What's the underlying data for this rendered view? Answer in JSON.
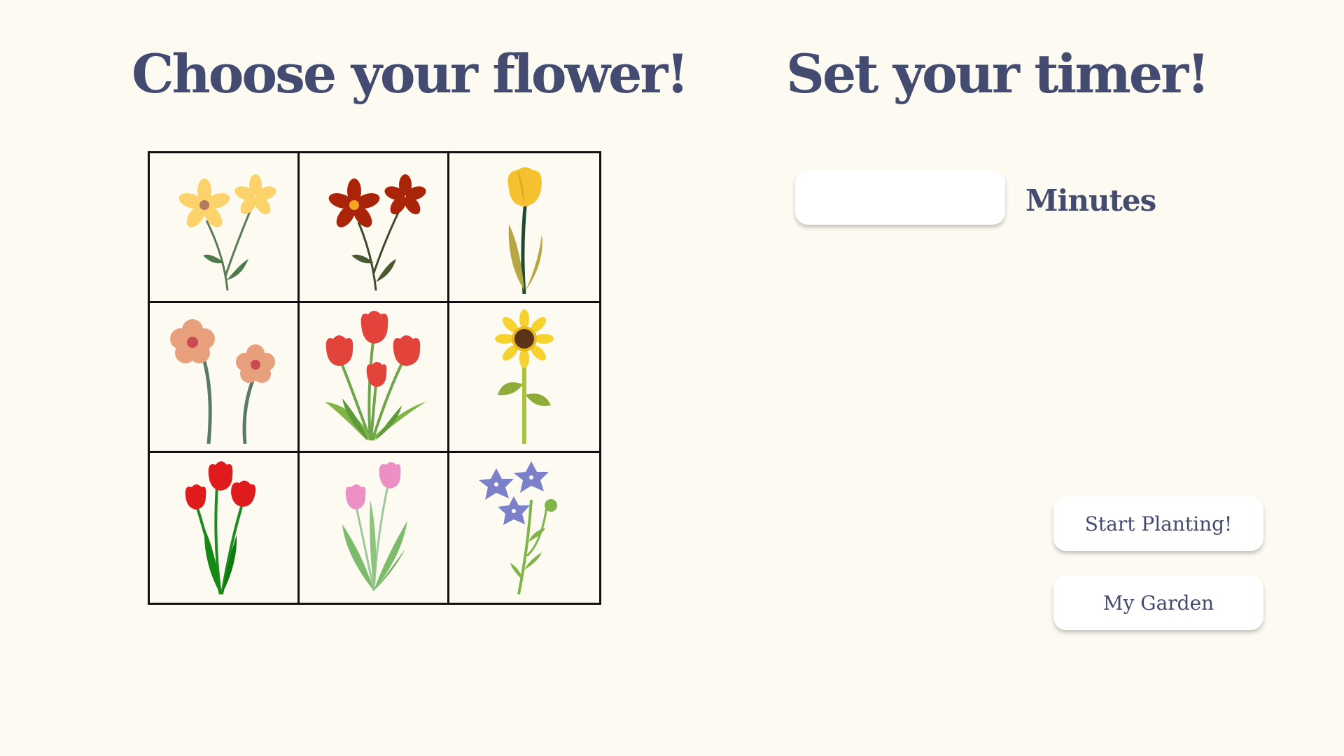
{
  "left_panel": {
    "title": "Choose your flower!",
    "flowers": [
      {
        "icon": "yellow-daisies-icon"
      },
      {
        "icon": "red-daisies-icon"
      },
      {
        "icon": "yellow-tulip-icon"
      },
      {
        "icon": "peach-flowers-icon"
      },
      {
        "icon": "red-tulip-bouquet-icon"
      },
      {
        "icon": "sunflower-icon"
      },
      {
        "icon": "red-tulips-icon"
      },
      {
        "icon": "pink-tulips-icon"
      },
      {
        "icon": "bellflower-icon"
      }
    ]
  },
  "right_panel": {
    "title": "Set your timer!",
    "timer": {
      "value": "",
      "placeholder": "",
      "unit_label": "Minutes"
    },
    "start_button_label": "Start Planting!",
    "garden_button_label": "My Garden"
  },
  "colors": {
    "background": "#fdfbf1",
    "heading": "#444b70",
    "button_bg": "#ffffff",
    "grid_line": "#111111"
  }
}
